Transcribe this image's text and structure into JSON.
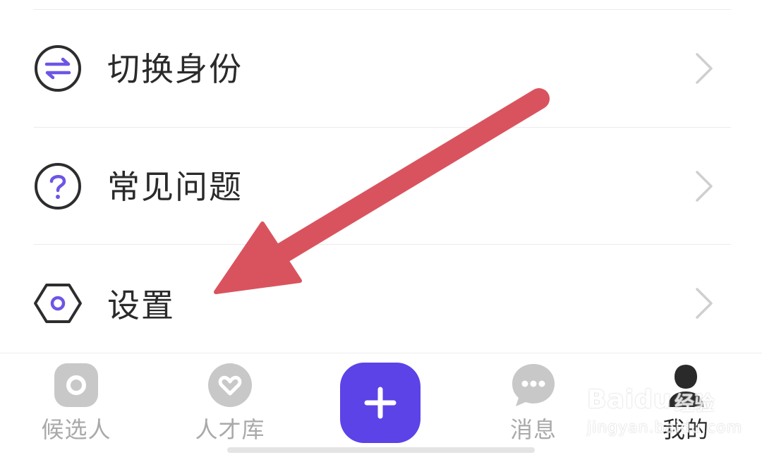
{
  "menu": {
    "items": [
      {
        "label": "切换身份",
        "icon": "switch-identity-icon"
      },
      {
        "label": "常见问题",
        "icon": "question-icon"
      },
      {
        "label": "设置",
        "icon": "settings-hexagon-icon"
      }
    ]
  },
  "tabbar": {
    "tabs": [
      {
        "label": "候选人",
        "icon": "candidate-icon",
        "active": false
      },
      {
        "label": "人才库",
        "icon": "talent-pool-heart-icon",
        "active": false
      },
      {
        "label": "",
        "icon": "add-plus-icon",
        "active": false
      },
      {
        "label": "消息",
        "icon": "message-chat-icon",
        "active": false
      },
      {
        "label": "我的",
        "icon": "profile-person-icon",
        "active": true
      }
    ]
  },
  "watermark": {
    "brand": "Baidu",
    "brand_cn": "经验",
    "url": "jingyan.baidu.com"
  },
  "colors": {
    "accent": "#5b43e8",
    "icon_purple": "#6e55e6",
    "arrow": "#d9535e",
    "inactive": "#a9a9a9",
    "text": "#2a2a2a"
  }
}
